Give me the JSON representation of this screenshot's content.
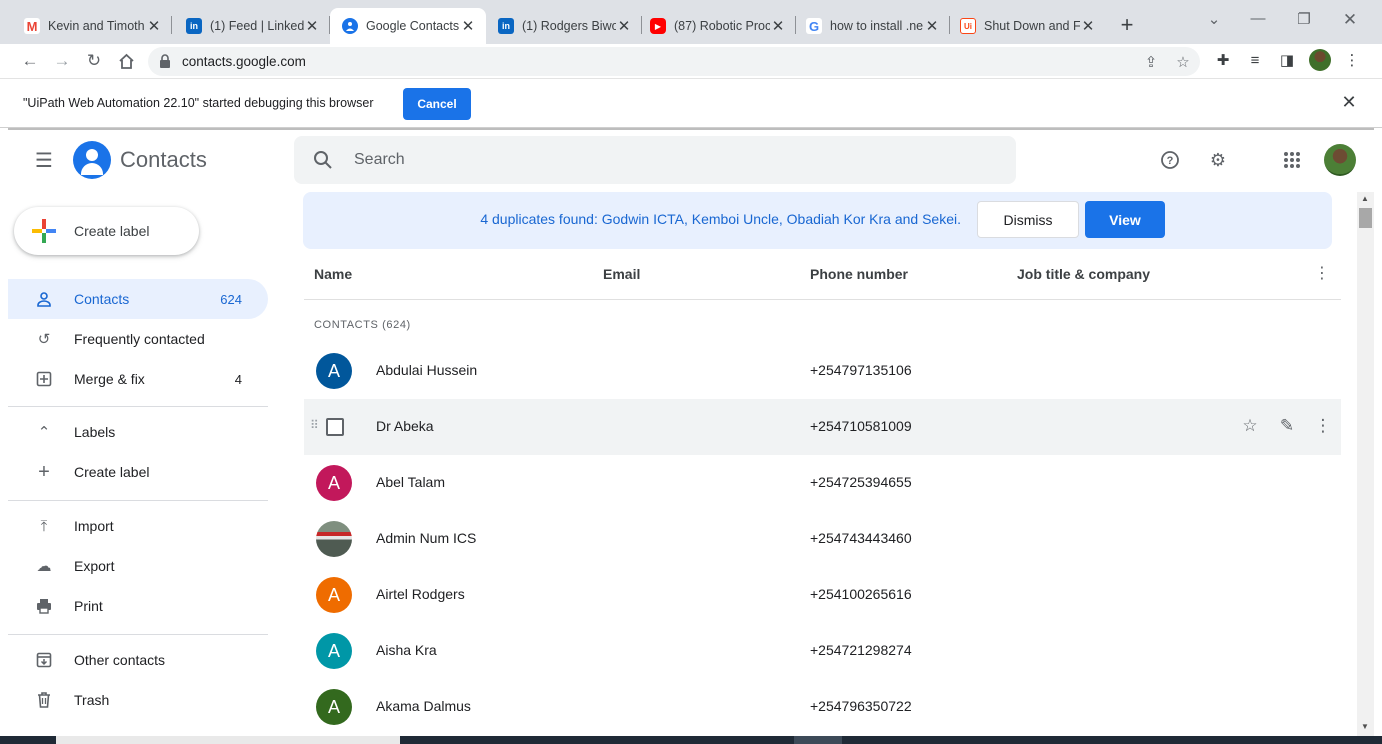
{
  "browser": {
    "tabs": [
      {
        "title": "Kevin and Timoth",
        "favicon": "gmail-icon",
        "color": "#ea4335",
        "glyph": "M",
        "active": false
      },
      {
        "title": "(1) Feed | LinkedI",
        "favicon": "linkedin-icon",
        "color": "#0a66c2",
        "glyph": "in",
        "active": false
      },
      {
        "title": "Google Contacts",
        "favicon": "contacts-icon",
        "color": "#1a73e8",
        "glyph": "",
        "active": true
      },
      {
        "title": "(1) Rodgers Biwo",
        "favicon": "linkedin-icon",
        "color": "#0a66c2",
        "glyph": "in",
        "active": false
      },
      {
        "title": "(87) Robotic Proc",
        "favicon": "youtube-icon",
        "color": "#ff0000",
        "glyph": "▶",
        "active": false
      },
      {
        "title": "how to install .ne",
        "favicon": "google-icon",
        "color": "#4285f4",
        "glyph": "G",
        "active": false
      },
      {
        "title": "Shut Down and F",
        "favicon": "uipath-icon",
        "color": "#fa4616",
        "glyph": "Ui",
        "active": false
      }
    ],
    "url": "contacts.google.com"
  },
  "debug_bar": {
    "message": "\"UiPath Web Automation 22.10\" started debugging this browser",
    "cancel_label": "Cancel"
  },
  "app": {
    "title": "Contacts",
    "search_placeholder": "Search"
  },
  "sidebar": {
    "create_label": "Create label",
    "items": [
      {
        "label": "Contacts",
        "count": "624",
        "icon": "person-icon",
        "active": true
      },
      {
        "label": "Frequently contacted",
        "count": "",
        "icon": "history-icon",
        "active": false
      },
      {
        "label": "Merge & fix",
        "count": "4",
        "icon": "merge-icon",
        "active": false
      }
    ],
    "labels_heading": "Labels",
    "io_items": [
      {
        "label": "Import",
        "icon": "upload-icon"
      },
      {
        "label": "Export",
        "icon": "cloud-download-icon"
      },
      {
        "label": "Print",
        "icon": "print-icon"
      }
    ],
    "bottom_items": [
      {
        "label": "Other contacts",
        "icon": "archive-icon"
      },
      {
        "label": "Trash",
        "icon": "trash-icon"
      }
    ]
  },
  "banner": {
    "message": "4 duplicates found: Godwin ICTA, Kemboi Uncle, Obadiah Kor Kra and Sekei.",
    "dismiss_label": "Dismiss",
    "view_label": "View"
  },
  "table": {
    "columns": {
      "name": "Name",
      "email": "Email",
      "phone": "Phone number",
      "job": "Job title & company"
    },
    "section_label": "CONTACTS (624)",
    "rows": [
      {
        "name": "Abdulai Hussein",
        "phone": "+254797135106",
        "initial": "A",
        "avatar_color": "#01579b",
        "type": "initial"
      },
      {
        "name": "Dr Abeka",
        "phone": "+254710581009",
        "initial": "",
        "avatar_color": "",
        "type": "hover"
      },
      {
        "name": "Abel Talam",
        "phone": "+254725394655",
        "initial": "A",
        "avatar_color": "#c2185b",
        "type": "initial"
      },
      {
        "name": "Admin Num ICS",
        "phone": "+254743443460",
        "initial": "",
        "avatar_color": "",
        "type": "photo"
      },
      {
        "name": "Airtel Rodgers",
        "phone": "+254100265616",
        "initial": "A",
        "avatar_color": "#ef6c00",
        "type": "initial"
      },
      {
        "name": "Aisha Kra",
        "phone": "+254721298274",
        "initial": "A",
        "avatar_color": "#0097a7",
        "type": "initial"
      },
      {
        "name": "Akama Dalmus",
        "phone": "+254796350722",
        "initial": "A",
        "avatar_color": "#33691e",
        "type": "initial"
      }
    ]
  }
}
